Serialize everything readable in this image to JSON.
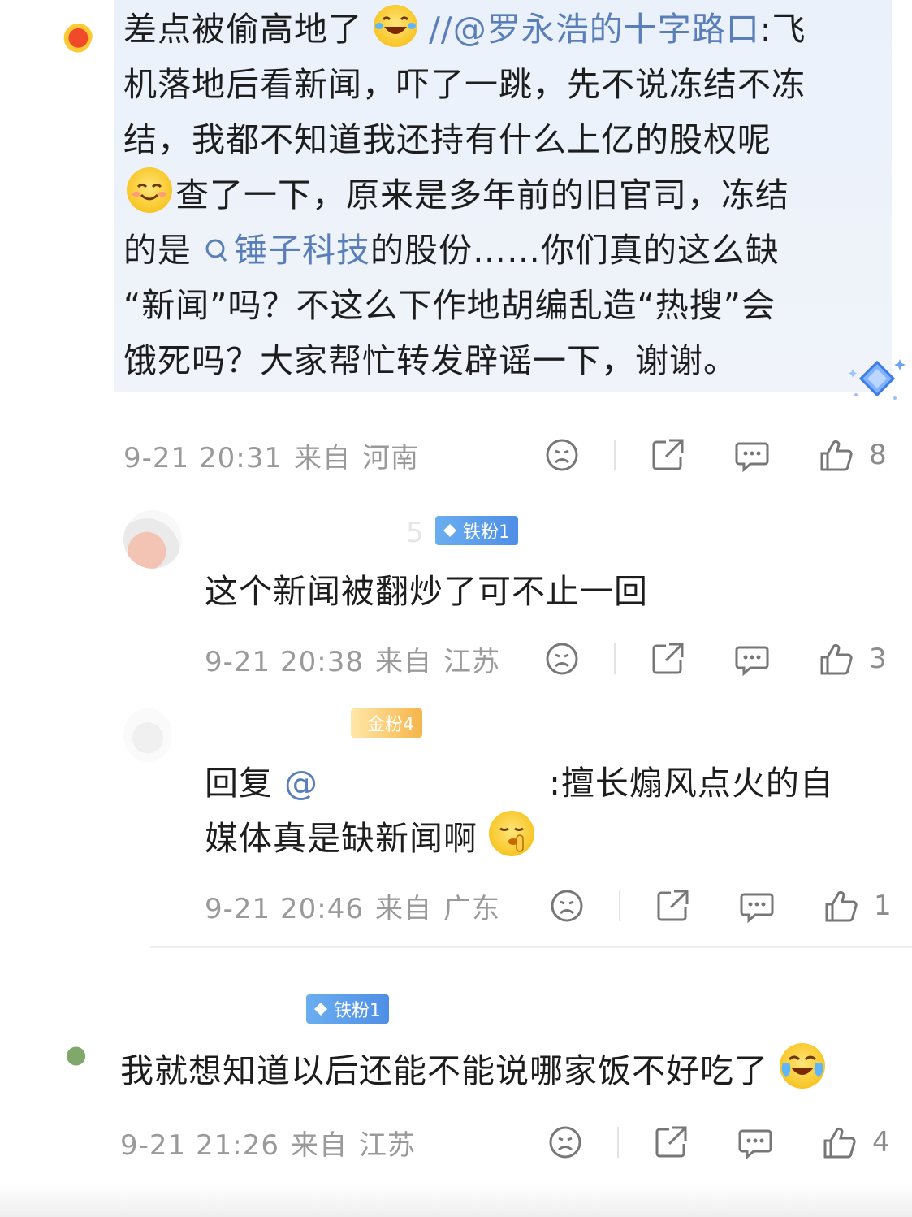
{
  "comments": [
    {
      "text_before_emoji": "差点被偷高地了",
      "emoji_1": "grinning-tears-emoji",
      "repost_prefix": "//",
      "mention": "@罗永浩的十字路口",
      "line_1_rest": ":飞",
      "line_2": "机落地后看新闻，吓了一跳，先不说冻结不冻",
      "line_3": "结，我都不知道我还持有什么上亿的股权呢",
      "emoji_2": "smile-emoji",
      "line_4_rest": "查了一下，原来是多年前的旧官司，冻结",
      "line_5_before_topic": "的是",
      "topic": "锤子科技",
      "line_5_after_topic": "的股份……你们真的这么缺",
      "line_6": "“新闻”吗？不这么下作地胡编乱造“热搜”会",
      "line_7": "饿死吗？大家帮忙转发辟谣一下，谢谢。",
      "time": "9-21 20:31",
      "from": "来自",
      "location": "河南",
      "likes": "8"
    },
    {
      "badge": "铁粉1",
      "text": "这个新闻被翻炒了可不止一回",
      "time": "9-21 20:38",
      "from": "来自",
      "location": "江苏",
      "likes": "3"
    },
    {
      "badge": "金粉4",
      "reply_prefix": "回复",
      "mention": "@",
      "reply_rest": ":擅长煽风点火的自",
      "line_2": "媒体真是缺新闻啊",
      "emoji": "shush-emoji",
      "time": "9-21 20:46",
      "from": "来自",
      "location": "广东",
      "likes": "1"
    },
    {
      "badge": "铁粉1",
      "text": "我就想知道以后还能不能说哪家饭不好吃了",
      "emoji": "laughing-cry-emoji",
      "time": "9-21 21:26",
      "from": "来自",
      "location": "江苏",
      "likes": "4"
    }
  ],
  "colors": {
    "link": "#5a7fb8",
    "meta": "#9a9a9a",
    "badge_blue": "#4f8ee6",
    "badge_gold": "#f6b54a",
    "bubble": "#eaf1fb"
  }
}
